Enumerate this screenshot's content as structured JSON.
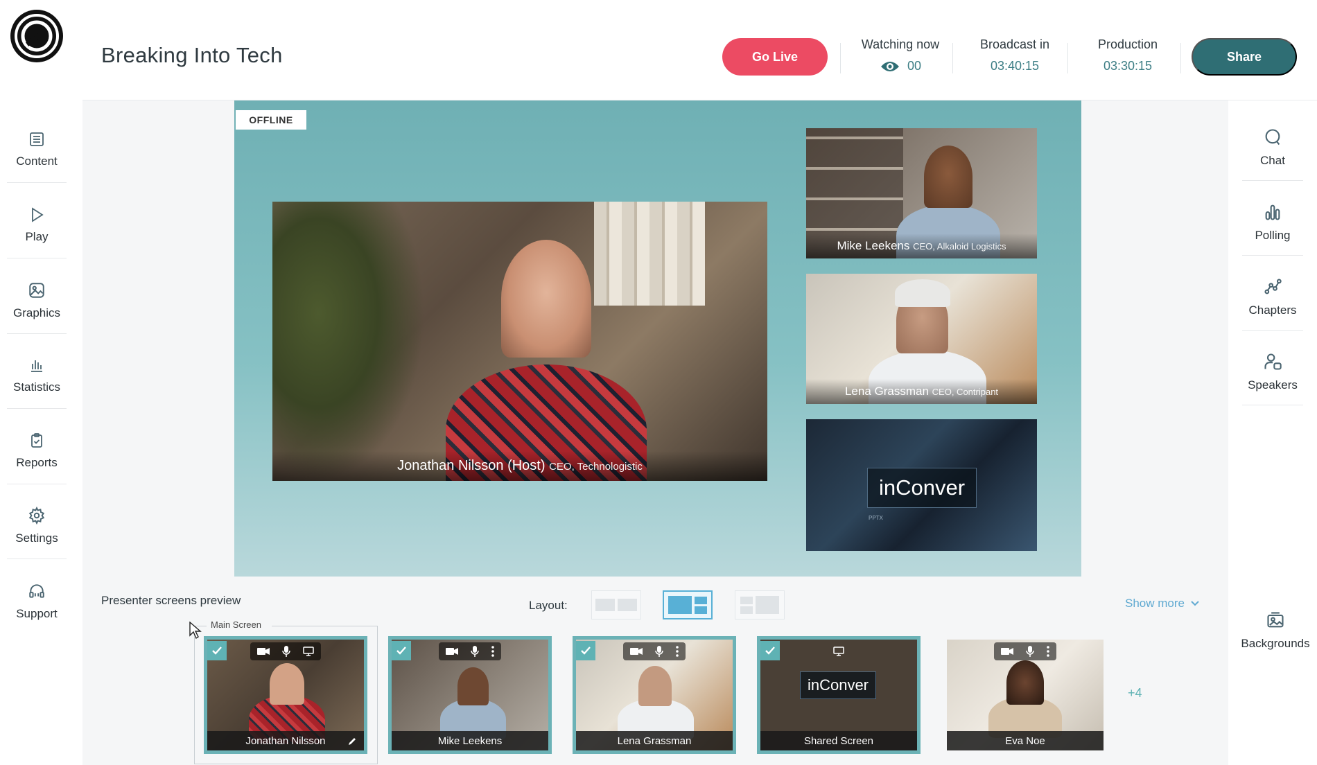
{
  "header": {
    "title": "Breaking Into Tech",
    "go_live": "Go Live",
    "watching_label": "Watching now",
    "watching_value": "00",
    "broadcast_label": "Broadcast in",
    "broadcast_value": "03:40:15",
    "production_label": "Production",
    "production_value": "03:30:15",
    "share": "Share"
  },
  "left_nav": {
    "items": [
      {
        "label": "Content",
        "icon": "content-icon"
      },
      {
        "label": "Play",
        "icon": "play-icon"
      },
      {
        "label": "Graphics",
        "icon": "image-icon"
      },
      {
        "label": "Statistics",
        "icon": "bar-chart-icon"
      },
      {
        "label": "Reports",
        "icon": "clipboard-icon"
      },
      {
        "label": "Settings",
        "icon": "gear-icon"
      },
      {
        "label": "Support",
        "icon": "headset-icon"
      }
    ]
  },
  "right_nav": {
    "items": [
      {
        "label": "Chat",
        "icon": "chat-icon"
      },
      {
        "label": "Polling",
        "icon": "poll-icon"
      },
      {
        "label": "Chapters",
        "icon": "chapters-icon"
      },
      {
        "label": "Speakers",
        "icon": "speakers-icon"
      }
    ],
    "backgrounds": "Backgrounds"
  },
  "stage": {
    "status": "OFFLINE",
    "main": {
      "name": "Jonathan Nilsson (Host)",
      "role": "CEO, Technologistic"
    },
    "side": [
      {
        "name": "Mike Leekens",
        "role": "CEO, Alkaloid Logistics"
      },
      {
        "name": "Lena Grassman",
        "role": "CEO, Contripant"
      }
    ],
    "slide": {
      "title": "inConver",
      "subtitle": "PPTX"
    }
  },
  "presenters": {
    "title": "Presenter screens preview",
    "layout_label": "Layout:",
    "show_more": "Show more",
    "main_screen_label": "Main Screen",
    "more_count": "+4",
    "items": [
      {
        "name": "Jonathan Nilsson"
      },
      {
        "name": "Mike Leekens"
      },
      {
        "name": "Lena Grassman"
      },
      {
        "name": "Shared Screen"
      },
      {
        "name": "Eva Noe"
      }
    ]
  },
  "colors": {
    "accent_red": "#ec4b63",
    "accent_teal": "#2f6e74",
    "stage_teal": "#7fb9bc",
    "link_blue": "#5fa9d1"
  }
}
